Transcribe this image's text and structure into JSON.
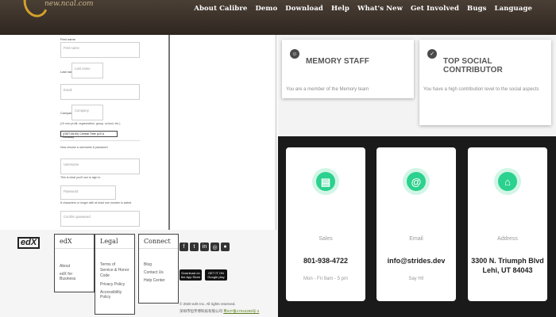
{
  "header": {
    "logo_text": "new.ncal.com",
    "nav": [
      "About Calibre",
      "Demo",
      "Download",
      "Help",
      "What's New",
      "Get Involved",
      "Bugs",
      "Language"
    ]
  },
  "form": {
    "first_name_label": "First name",
    "first_name_placeholder": "First name",
    "last_name_label": "Last name",
    "last_name_placeholder": "Last name",
    "email_placeholder": "Email",
    "company_label": "Company",
    "company_placeholder": "Company",
    "company_note": "(Or non-profit, organization, group, school, etc.)",
    "timezone_value": "(GMT-06:00) Central Time (US & Canada)",
    "credentials_heading": "Now choose a username & password",
    "username_placeholder": "Username",
    "username_note": "This is what you'll use to sign in.",
    "password_placeholder": "Password",
    "password_note": "8 characters or longer with at least one number is safest",
    "confirm_placeholder": "Confirm password"
  },
  "footer": {
    "logo": "edX",
    "col_edx": {
      "title": "edX",
      "items": [
        "About",
        "edX for Business"
      ]
    },
    "col_legal": {
      "title": "Legal",
      "items": [
        "Terms of Service & Honor Code",
        "Privacy Policy",
        "Accessibility Policy"
      ]
    },
    "col_connect": {
      "title": "Connect",
      "items": [
        "Blog",
        "Contact Us",
        "Help Center"
      ]
    },
    "social_icons": [
      "facebook-icon",
      "twitter-icon",
      "linkedin-icon",
      "instagram-icon",
      "reddit-icon"
    ],
    "app_store": "Download on the App Store",
    "google_play": "GET IT ON Google play",
    "copyright": "© 2020 edX Inc. All rights reserved.",
    "icp_text": "深圳市恒宇博科技有限公司",
    "icp_link": "粤ICP备17044299号-2"
  },
  "badges": [
    {
      "icon": "avatar-icon",
      "title": "MEMORY STAFF",
      "text": "You are a member of the Memory team"
    },
    {
      "icon": "shield-check-icon",
      "title": "TOP SOCIAL CONTRIBUTOR",
      "text": "You have a high contribution level to the social aspects"
    }
  ],
  "contacts": [
    {
      "icon": "phone-icon",
      "label": "Sales",
      "value": "801-938-4722",
      "sub": "Mon - Fri 9am - 5 pm"
    },
    {
      "icon": "at-icon",
      "label": "Email",
      "value": "info@strides.dev",
      "sub": "Say Hi!"
    },
    {
      "icon": "location-icon",
      "label": "Address",
      "value_line1": "3300 N. Triumph Blvd",
      "value_line2": "Lehi, UT 84043"
    }
  ],
  "colors": {
    "accent_green": "#2bd18e",
    "header_brown": "#3b322a",
    "dark_section": "#1a1a1a"
  }
}
